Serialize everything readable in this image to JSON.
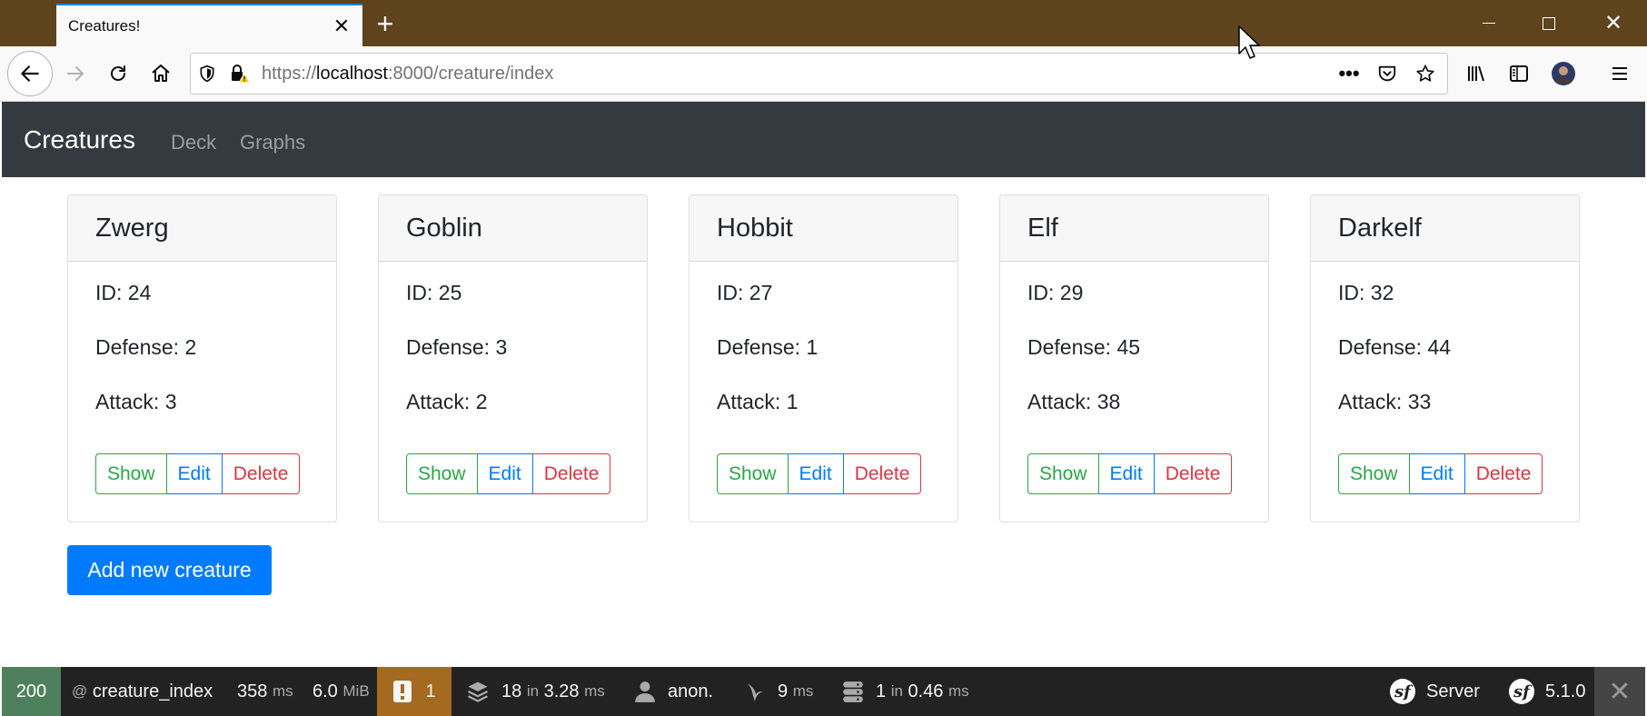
{
  "browser": {
    "tab_title": "Creatures!",
    "url_scheme": "https://",
    "url_host": "localhost",
    "url_rest": ":8000/creature/index"
  },
  "site": {
    "brand": "Creatures",
    "nav": [
      "Deck",
      "Graphs"
    ]
  },
  "creatures": [
    {
      "name": "Zwerg",
      "id": "ID: 24",
      "defense": "Defense: 2",
      "attack": "Attack: 3"
    },
    {
      "name": "Goblin",
      "id": "ID: 25",
      "defense": "Defense: 3",
      "attack": "Attack: 2"
    },
    {
      "name": "Hobbit",
      "id": "ID: 27",
      "defense": "Defense: 1",
      "attack": "Attack: 1"
    },
    {
      "name": "Elf",
      "id": "ID: 29",
      "defense": "Defense: 45",
      "attack": "Attack: 38"
    },
    {
      "name": "Darkelf",
      "id": "ID: 32",
      "defense": "Defense: 44",
      "attack": "Attack: 33"
    }
  ],
  "actions": {
    "show": "Show",
    "edit": "Edit",
    "delete": "Delete"
  },
  "add_button": "Add new creature",
  "toolbar": {
    "status": "200",
    "route_prefix": "@",
    "route": "creature_index",
    "time": "358",
    "time_unit": "ms",
    "memory": "6.0",
    "memory_unit": "MiB",
    "warnings": "1",
    "twig_count": "18",
    "twig_in": "in",
    "twig_time": "3.28",
    "twig_unit": "ms",
    "user": "anon.",
    "cache_time": "9",
    "cache_unit": "ms",
    "db_count": "1",
    "db_in": "in",
    "db_time": "0.46",
    "db_unit": "ms",
    "server": "Server",
    "version": "5.1.0",
    "colors": {
      "status_ok": "#4f805d",
      "warning": "#a46a1f"
    }
  }
}
